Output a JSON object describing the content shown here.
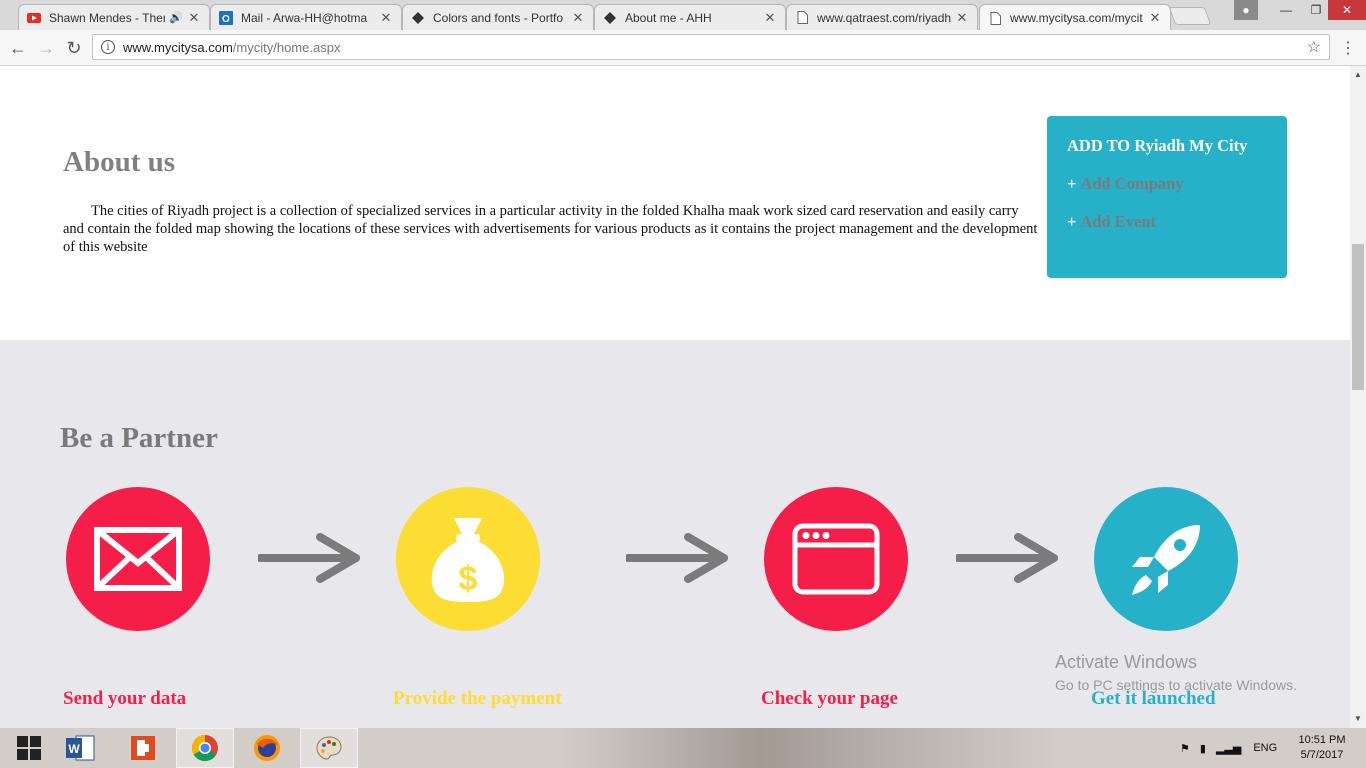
{
  "browser": {
    "tabs": [
      {
        "title": "Shawn Mendes - Ther",
        "icon": "youtube-icon",
        "audio": true,
        "active": false
      },
      {
        "title": "Mail - Arwa-HH@hotma",
        "icon": "outlook-icon",
        "active": false
      },
      {
        "title": "Colors and fonts - Portfo",
        "icon": "site-icon",
        "active": false
      },
      {
        "title": "About me - AHH",
        "icon": "site-icon",
        "active": false
      },
      {
        "title": "www.qatraest.com/riyadh",
        "icon": "page-icon",
        "active": false
      },
      {
        "title": "www.mycitysa.com/mycit",
        "icon": "page-icon",
        "active": true
      }
    ],
    "url_host": "www.mycitysa.com",
    "url_path": "/mycity/home.aspx"
  },
  "page": {
    "about": {
      "title": "About us",
      "text": "The cities of Riyadh project is a collection of specialized services in a particular activity in the folded Khalha maak work sized card reservation and easily carry and contain the folded map showing the locations of these services with advertisements for various products as it contains the project management and the development of this website"
    },
    "add_box": {
      "title": "ADD TO Ryiadh My City",
      "plus": "+",
      "add_company": "Add Company",
      "add_event": "Add Event",
      "color": "#27b1c8"
    },
    "partner": {
      "title": "Be a Partner",
      "steps": [
        {
          "label": "Send your data",
          "icon": "envelope-icon",
          "color": "#f51e48"
        },
        {
          "label": "Provide the payment",
          "icon": "money-bag-icon",
          "color": "#fbdd33"
        },
        {
          "label": "Check your page",
          "icon": "browser-window-icon",
          "color": "#f51e48"
        },
        {
          "label": "Get it launched",
          "icon": "rocket-icon",
          "color": "#27b1c8"
        }
      ]
    }
  },
  "watermark": {
    "line1": "Activate Windows",
    "line2": "Go to PC settings to activate Windows."
  },
  "taskbar": {
    "language": "ENG",
    "time": "10:51 PM",
    "date": "5/7/2017"
  }
}
